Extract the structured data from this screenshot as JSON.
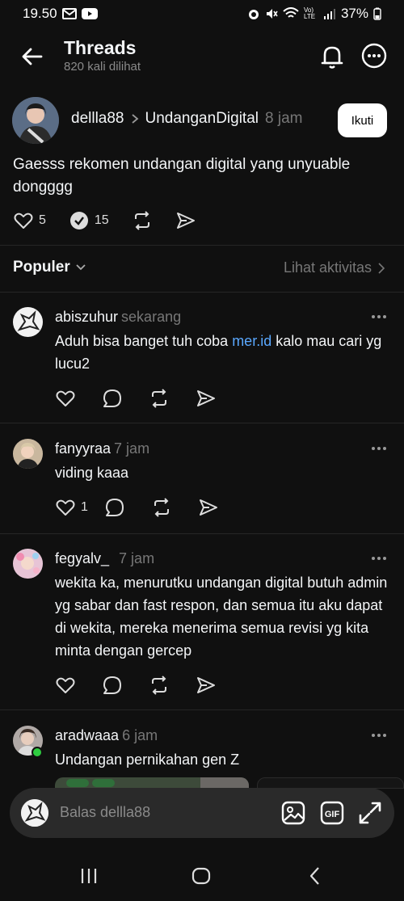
{
  "status": {
    "time": "19.50",
    "battery": "37%",
    "network": "Vo) LTE"
  },
  "header": {
    "title": "Threads",
    "subtitle": "820 kali dilihat"
  },
  "post": {
    "username": "dellla88",
    "community": "UndanganDigital",
    "time": "8 jam",
    "follow_label": "Ikuti",
    "text": "Gaesss rekomen undangan digital yang unyuable dongggg",
    "likes": "5",
    "reposts": "15"
  },
  "sort": {
    "label": "Populer",
    "activity": "Lihat aktivitas"
  },
  "replies": [
    {
      "username": "abiszuhur",
      "time": "sekarang",
      "text_before": "Aduh bisa banget tuh coba ",
      "link": "mer.id",
      "text_after": " kalo mau cari yg lucu2",
      "likes": ""
    },
    {
      "username": "fanyyraa",
      "time": "7 jam",
      "text": "viding kaaa",
      "likes": "1"
    },
    {
      "username": "fegyalv_",
      "time": "7 jam",
      "text": "wekita ka, menurutku undangan digital butuh admin yg sabar dan fast respon, dan semua itu aku dapat di wekita, mereka menerima semua revisi yg kita minta dengan gercep",
      "likes": ""
    },
    {
      "username": "aradwaaa",
      "time": "6 jam",
      "text": "Undangan pernikahan gen Z",
      "likes": ""
    }
  ],
  "composer": {
    "placeholder": "Balas dellla88"
  },
  "colors": {
    "background": "#101010",
    "link": "#5aa8ff",
    "muted": "#777777",
    "online": "#2ecc40"
  }
}
